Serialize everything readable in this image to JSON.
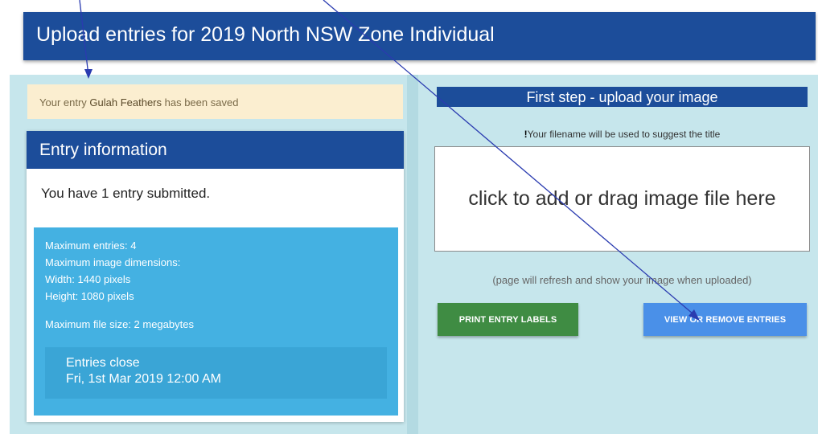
{
  "page": {
    "title": "Upload entries for 2019 North NSW Zone Individual"
  },
  "alert": {
    "prefix": "Your entry ",
    "entry_name": "Gulah Feathers",
    "suffix": " has been saved"
  },
  "entry_info": {
    "heading": "Entry information",
    "summary": "You have 1 entry submitted.",
    "limits": {
      "max_entries": "Maximum entries: 4",
      "max_dimensions": "Maximum image dimensions:",
      "width": "Width: 1440 pixels",
      "height": "Height: 1080 pixels",
      "max_file_size": "Maximum file size: 2 megabytes"
    },
    "close": {
      "label": "Entries close",
      "date": "Fri, 1st Mar 2019 12:00 AM"
    }
  },
  "upload": {
    "heading": "First step - upload your image",
    "note_mark": "!",
    "note": "Your filename will be used to suggest the title",
    "dropzone_text": "click to add or drag image file here",
    "refresh_note": "(page will refresh and show your image when uploaded)"
  },
  "buttons": {
    "print": "PRINT ENTRY LABELS",
    "view": "VIEW OR REMOVE ENTRIES"
  },
  "colors": {
    "header_blue": "#1c4d9a",
    "panel_bg": "#c6e6ec",
    "alert_bg": "#fbeed0",
    "limits_bg": "#44b1e2",
    "print_green": "#3f8c43",
    "view_blue": "#4a90e8",
    "annotation_arrow": "#2a3bb0"
  }
}
